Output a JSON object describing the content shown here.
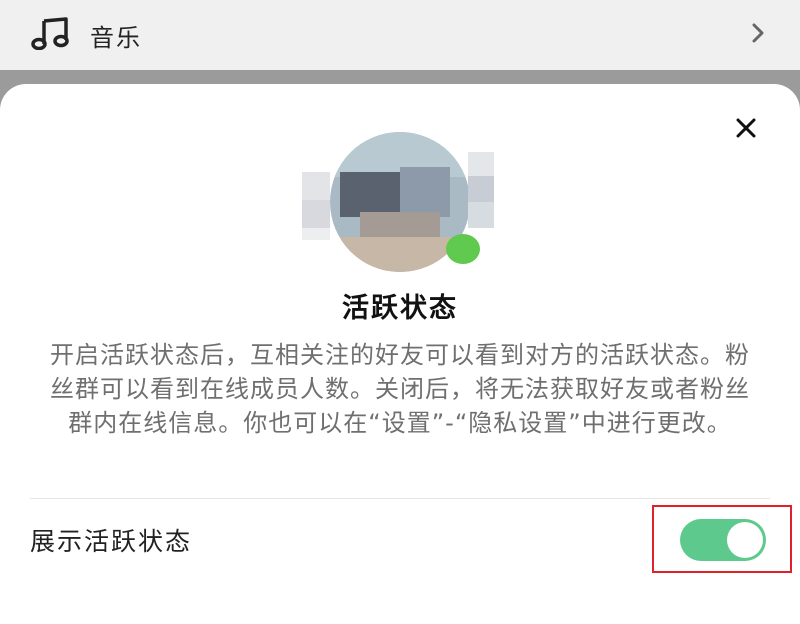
{
  "music_row": {
    "label": "音乐"
  },
  "dialog": {
    "title": "活跃状态",
    "description": "开启活跃状态后，互相关注的好友可以看到对方的活跃状态。粉丝群可以看到在线成员人数。关闭后，将无法获取好友或者粉丝群内在线信息。你也可以在“设置”-“隐私设置”中进行更改。",
    "toggle_label": "展示活跃状态",
    "toggle_on": true
  },
  "colors": {
    "toggle_on": "#5ec98c",
    "status_dot": "#5fca4e",
    "highlight": "#e0212b"
  }
}
